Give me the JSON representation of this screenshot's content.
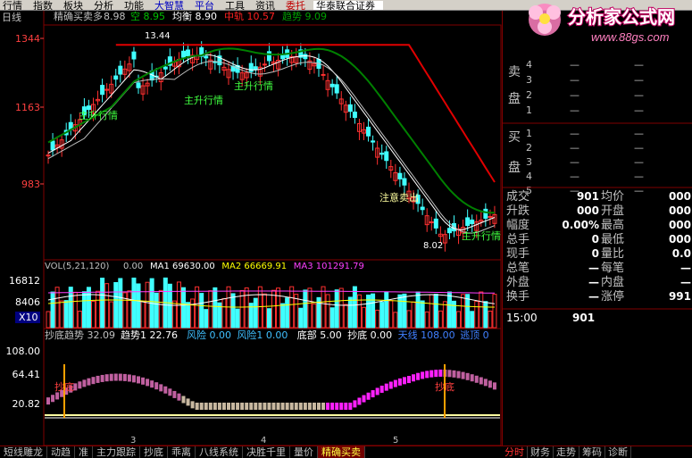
{
  "menubar": {
    "items": [
      {
        "label": "行情",
        "tone": ""
      },
      {
        "label": "指数",
        "tone": ""
      },
      {
        "label": "板块",
        "tone": ""
      },
      {
        "label": "分析",
        "tone": ""
      },
      {
        "label": "功能",
        "tone": ""
      },
      {
        "label": "大智慧",
        "tone": "blue"
      },
      {
        "label": "平台",
        "tone": "blue"
      },
      {
        "label": "工具",
        "tone": ""
      },
      {
        "label": "资讯",
        "tone": ""
      },
      {
        "label": "委托",
        "tone": "red"
      },
      {
        "label": "华泰联合证券",
        "tone": "sel"
      }
    ]
  },
  "logo": {
    "title": "分析家公式网",
    "url": "www.88gs.com"
  },
  "main_chart": {
    "period": "日线",
    "indicator_name": "精确买卖多",
    "indicator_value": "8.98",
    "legend": [
      {
        "label": "空",
        "value": "8.95",
        "color": "#00c000"
      },
      {
        "label": "均衡",
        "value": "8.90",
        "color": "#ffffff"
      },
      {
        "label": "中轨",
        "value": "10.57",
        "color": "#ff2020"
      },
      {
        "label": "趋势",
        "value": "9.09",
        "color": "#00a000"
      }
    ],
    "y_ticks": [
      "1344",
      "1163",
      "983"
    ],
    "high_label": "13.44",
    "low_label": "8.02",
    "annotations": [
      {
        "text": "主升行情",
        "color": "#40ff40"
      },
      {
        "text": "主升行情",
        "color": "#40ff40"
      },
      {
        "text": "主升行情",
        "color": "#40ff40"
      },
      {
        "text": "注意卖出",
        "color": "#ffffa0"
      },
      {
        "text": "主升行情",
        "color": "#40ff40"
      }
    ]
  },
  "volume_chart": {
    "header": "VOL(5,21,120)",
    "header_value": "0.00",
    "legend": [
      {
        "label": "MA1",
        "value": "69630.00",
        "color": "#ffffff"
      },
      {
        "label": "MA2",
        "value": "66669.91",
        "color": "#ffff00"
      },
      {
        "label": "MA3",
        "value": "101291.79",
        "color": "#ff40ff"
      }
    ],
    "y_ticks": [
      "16812",
      "8406"
    ],
    "unit": "X10"
  },
  "osc_chart": {
    "legend": [
      {
        "label": "抄底趋势",
        "value": "32.09",
        "color": "#c0c0c0"
      },
      {
        "label": "趋势1",
        "value": "22.76",
        "color": "#ffffff"
      },
      {
        "label": "风险",
        "value": "0.00",
        "color": "#40c0ff"
      },
      {
        "label": "风险1",
        "value": "0.00",
        "color": "#40c0ff"
      },
      {
        "label": "底部",
        "value": "5.00",
        "color": "#ffffff"
      },
      {
        "label": "抄底",
        "value": "0.00",
        "color": "#ffffff"
      },
      {
        "label": "天线",
        "value": "108.00",
        "color": "#4080ff"
      },
      {
        "label": "逃顶",
        "value": "0",
        "color": "#4080ff"
      }
    ],
    "y_ticks": [
      "108.00",
      "64.41",
      "20.82"
    ],
    "signals": [
      "抄底",
      "抄底"
    ],
    "month_marks": [
      "3",
      "4",
      "5"
    ]
  },
  "bottom_tabs": [
    "短线雕龙",
    "动趋",
    "准",
    "主力跟踪",
    "抄底",
    "乖离",
    "八线系统",
    "决胜千里",
    "量价",
    "精确买卖"
  ],
  "active_bottom_tab": 9,
  "right_panel": {
    "sell": {
      "group": "卖盘",
      "rows": [
        {
          "n": "4",
          "p": "—",
          "v": "—"
        },
        {
          "n": "3",
          "p": "—",
          "v": "—"
        },
        {
          "n": "2",
          "p": "—",
          "v": "—"
        },
        {
          "n": "1",
          "p": "—",
          "v": "—"
        }
      ]
    },
    "buy": {
      "group": "买盘",
      "rows": [
        {
          "n": "1",
          "p": "—",
          "v": "—"
        },
        {
          "n": "2",
          "p": "—",
          "v": "—"
        },
        {
          "n": "3",
          "p": "—",
          "v": "—"
        },
        {
          "n": "4",
          "p": "—",
          "v": "—"
        },
        {
          "n": "5",
          "p": "—",
          "v": "—"
        }
      ]
    },
    "stats": [
      {
        "l1": "成交",
        "v1": "901",
        "l2": "均价",
        "v2": "000"
      },
      {
        "l1": "升跌",
        "v1": "000",
        "l2": "开盘",
        "v2": "000"
      },
      {
        "l1": "幅度",
        "v1": "0.00%",
        "l2": "最高",
        "v2": "000"
      },
      {
        "l1": "总手",
        "v1": "0",
        "l2": "最低",
        "v2": "000"
      },
      {
        "l1": "现手",
        "v1": "0",
        "l2": "量比",
        "v2": "0.0"
      },
      {
        "l1": "总笔",
        "v1": "—",
        "l2": "每笔",
        "v2": "—"
      },
      {
        "l1": "外盘",
        "v1": "—",
        "l2": "内盘",
        "v2": "—"
      },
      {
        "l1": "换手",
        "v1": "—",
        "l2": "涨停",
        "v2": "991"
      }
    ],
    "tick": {
      "time": "15:00",
      "price": "901"
    },
    "tabs": [
      "分时",
      "财务",
      "走势",
      "筹码",
      "诊断"
    ],
    "active_tab": 0
  },
  "colors": {
    "up_candle": "#ff3030",
    "down_candle": "#40ffff",
    "red_line": "#e00000",
    "green_line": "#008000",
    "white_line": "#ffffff",
    "label_green": "#40ff40",
    "label_yellow": "#ffffa0",
    "frame": "#800000"
  }
}
